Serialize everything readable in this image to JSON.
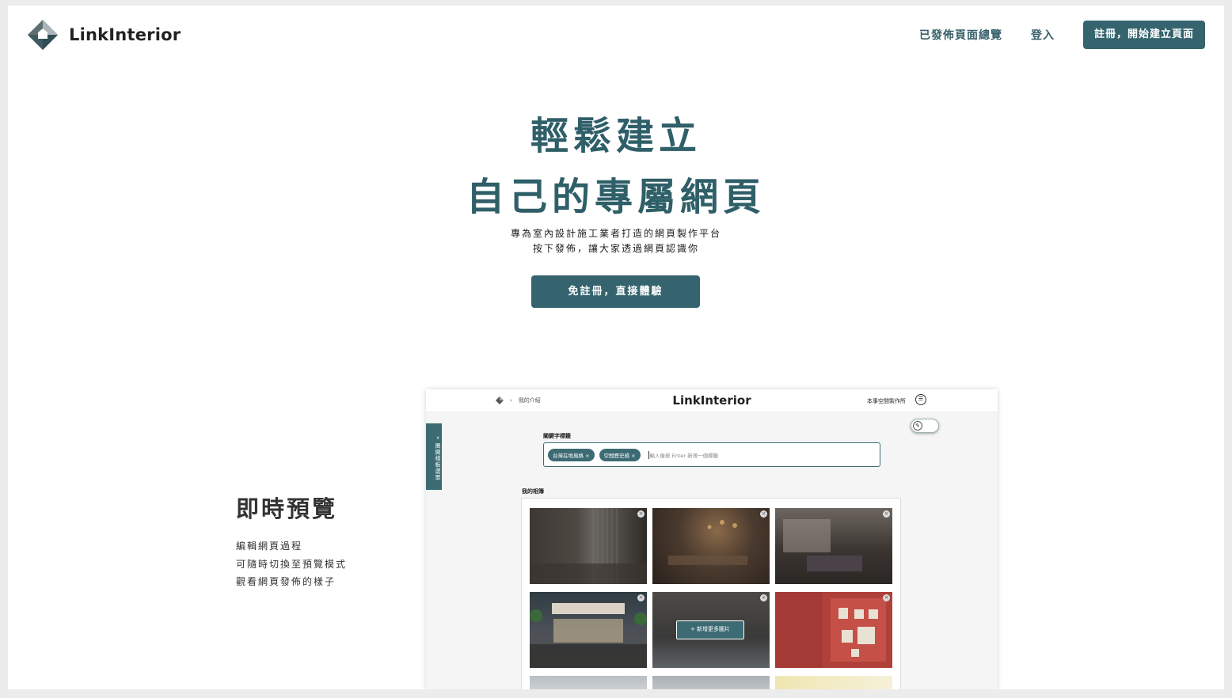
{
  "header": {
    "logo_text": "LinkInterior",
    "nav_published": "已發佈頁面總覽",
    "nav_login": "登入",
    "nav_register": "註冊，開始建立頁面"
  },
  "hero": {
    "title_line1": "輕鬆建立",
    "title_line2": "自己的專屬網頁",
    "subtitle_line1": "專為室內設計施工業者打造的網頁製作平台",
    "subtitle_line2": "按下發佈，讓大家透過網頁認識你",
    "cta": "免註冊，直接體驗"
  },
  "feature": {
    "title": "即時預覽",
    "lines": [
      "編輯網頁過程",
      "可隨時切換至預覽模式",
      "觀看網頁發佈的樣子"
    ]
  },
  "preview": {
    "breadcrumb_sep": "›",
    "breadcrumb_page": "我的介紹",
    "brand": "LinkInterior",
    "studio": "本事空間製作所",
    "side_menu": "展開樣板選單",
    "keywords_label": "關鍵字標籤",
    "tags": [
      "台灣在地風格 ×",
      "空間歷史感 ×"
    ],
    "keyword_placeholder": "輸入後按 Enter 新增一個標籤",
    "album_label": "我的相簿",
    "add_more": "+ 新增更多圖片",
    "remove_icon": "×"
  },
  "colors": {
    "brand": "#35646e",
    "title": "#2f5f68"
  }
}
